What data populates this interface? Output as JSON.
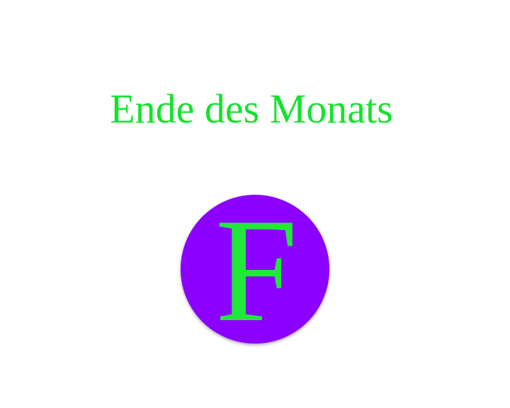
{
  "title": {
    "text": "Ende des Monats",
    "color": "#14e32d"
  },
  "badge": {
    "letter": "F",
    "letter_color": "#22e83a",
    "background_color": "#8b00ff"
  }
}
